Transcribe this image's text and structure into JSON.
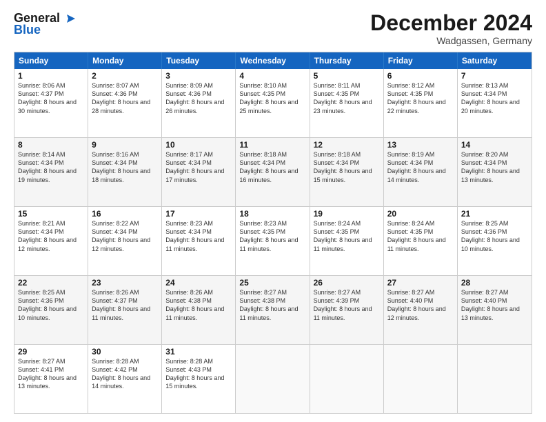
{
  "logo": {
    "line1": "General",
    "line2": "Blue"
  },
  "title": "December 2024",
  "location": "Wadgassen, Germany",
  "days_header": [
    "Sunday",
    "Monday",
    "Tuesday",
    "Wednesday",
    "Thursday",
    "Friday",
    "Saturday"
  ],
  "weeks": [
    [
      {
        "day": "1",
        "sunrise": "8:06 AM",
        "sunset": "4:37 PM",
        "daylight": "8 hours and 30 minutes."
      },
      {
        "day": "2",
        "sunrise": "8:07 AM",
        "sunset": "4:36 PM",
        "daylight": "8 hours and 28 minutes."
      },
      {
        "day": "3",
        "sunrise": "8:09 AM",
        "sunset": "4:36 PM",
        "daylight": "8 hours and 26 minutes."
      },
      {
        "day": "4",
        "sunrise": "8:10 AM",
        "sunset": "4:35 PM",
        "daylight": "8 hours and 25 minutes."
      },
      {
        "day": "5",
        "sunrise": "8:11 AM",
        "sunset": "4:35 PM",
        "daylight": "8 hours and 23 minutes."
      },
      {
        "day": "6",
        "sunrise": "8:12 AM",
        "sunset": "4:35 PM",
        "daylight": "8 hours and 22 minutes."
      },
      {
        "day": "7",
        "sunrise": "8:13 AM",
        "sunset": "4:34 PM",
        "daylight": "8 hours and 20 minutes."
      }
    ],
    [
      {
        "day": "8",
        "sunrise": "8:14 AM",
        "sunset": "4:34 PM",
        "daylight": "8 hours and 19 minutes."
      },
      {
        "day": "9",
        "sunrise": "8:16 AM",
        "sunset": "4:34 PM",
        "daylight": "8 hours and 18 minutes."
      },
      {
        "day": "10",
        "sunrise": "8:17 AM",
        "sunset": "4:34 PM",
        "daylight": "8 hours and 17 minutes."
      },
      {
        "day": "11",
        "sunrise": "8:18 AM",
        "sunset": "4:34 PM",
        "daylight": "8 hours and 16 minutes."
      },
      {
        "day": "12",
        "sunrise": "8:18 AM",
        "sunset": "4:34 PM",
        "daylight": "8 hours and 15 minutes."
      },
      {
        "day": "13",
        "sunrise": "8:19 AM",
        "sunset": "4:34 PM",
        "daylight": "8 hours and 14 minutes."
      },
      {
        "day": "14",
        "sunrise": "8:20 AM",
        "sunset": "4:34 PM",
        "daylight": "8 hours and 13 minutes."
      }
    ],
    [
      {
        "day": "15",
        "sunrise": "8:21 AM",
        "sunset": "4:34 PM",
        "daylight": "8 hours and 12 minutes."
      },
      {
        "day": "16",
        "sunrise": "8:22 AM",
        "sunset": "4:34 PM",
        "daylight": "8 hours and 12 minutes."
      },
      {
        "day": "17",
        "sunrise": "8:23 AM",
        "sunset": "4:34 PM",
        "daylight": "8 hours and 11 minutes."
      },
      {
        "day": "18",
        "sunrise": "8:23 AM",
        "sunset": "4:35 PM",
        "daylight": "8 hours and 11 minutes."
      },
      {
        "day": "19",
        "sunrise": "8:24 AM",
        "sunset": "4:35 PM",
        "daylight": "8 hours and 11 minutes."
      },
      {
        "day": "20",
        "sunrise": "8:24 AM",
        "sunset": "4:35 PM",
        "daylight": "8 hours and 11 minutes."
      },
      {
        "day": "21",
        "sunrise": "8:25 AM",
        "sunset": "4:36 PM",
        "daylight": "8 hours and 10 minutes."
      }
    ],
    [
      {
        "day": "22",
        "sunrise": "8:25 AM",
        "sunset": "4:36 PM",
        "daylight": "8 hours and 10 minutes."
      },
      {
        "day": "23",
        "sunrise": "8:26 AM",
        "sunset": "4:37 PM",
        "daylight": "8 hours and 11 minutes."
      },
      {
        "day": "24",
        "sunrise": "8:26 AM",
        "sunset": "4:38 PM",
        "daylight": "8 hours and 11 minutes."
      },
      {
        "day": "25",
        "sunrise": "8:27 AM",
        "sunset": "4:38 PM",
        "daylight": "8 hours and 11 minutes."
      },
      {
        "day": "26",
        "sunrise": "8:27 AM",
        "sunset": "4:39 PM",
        "daylight": "8 hours and 11 minutes."
      },
      {
        "day": "27",
        "sunrise": "8:27 AM",
        "sunset": "4:40 PM",
        "daylight": "8 hours and 12 minutes."
      },
      {
        "day": "28",
        "sunrise": "8:27 AM",
        "sunset": "4:40 PM",
        "daylight": "8 hours and 13 minutes."
      }
    ],
    [
      {
        "day": "29",
        "sunrise": "8:27 AM",
        "sunset": "4:41 PM",
        "daylight": "8 hours and 13 minutes."
      },
      {
        "day": "30",
        "sunrise": "8:28 AM",
        "sunset": "4:42 PM",
        "daylight": "8 hours and 14 minutes."
      },
      {
        "day": "31",
        "sunrise": "8:28 AM",
        "sunset": "4:43 PM",
        "daylight": "8 hours and 15 minutes."
      },
      null,
      null,
      null,
      null
    ]
  ]
}
